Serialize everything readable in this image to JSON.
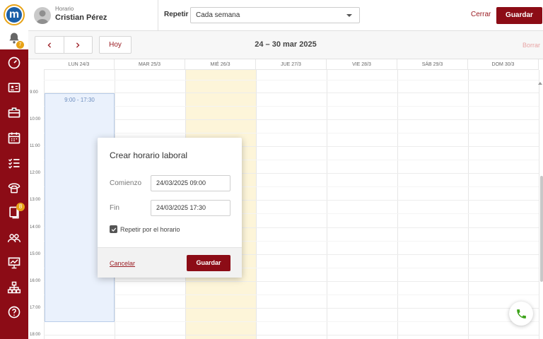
{
  "header": {
    "subtitle": "Horario",
    "user_name": "Cristian Pérez",
    "repeat_label": "Repetir",
    "repeat_value": "Cada semana",
    "cancel_label": "Cerrar",
    "save_label": "Guardar"
  },
  "notifications": {
    "badge": "7"
  },
  "sidebar": {
    "items": [
      {
        "icon": "dashboard-icon"
      },
      {
        "icon": "id-card-icon"
      },
      {
        "icon": "briefcase-icon"
      },
      {
        "icon": "calendar-icon"
      },
      {
        "icon": "checklist-icon"
      },
      {
        "icon": "phone-icon"
      },
      {
        "icon": "documents-icon",
        "badge": "8"
      },
      {
        "icon": "users-icon"
      },
      {
        "icon": "presentation-icon"
      },
      {
        "icon": "org-chart-icon"
      },
      {
        "icon": "help-icon"
      }
    ]
  },
  "toolbar": {
    "today_label": "Hoy",
    "date_range": "24 – 30 mar 2025",
    "clear_label": "Borrar"
  },
  "calendar": {
    "days": [
      "LUN 24/3",
      "MAR 25/3",
      "MIÉ 26/3",
      "JUE 27/3",
      "VIE 28/3",
      "SÁB 29/3",
      "DOM 30/3"
    ],
    "hours": [
      "9:00",
      "10:00",
      "11:00",
      "12:00",
      "13:00",
      "14:00",
      "15:00",
      "16:00",
      "17:00",
      "18:00"
    ],
    "event_label": "9:00 - 17:30"
  },
  "dialog": {
    "title": "Crear horario laboral",
    "start_label": "Comienzo",
    "start_value": "24/03/2025 09:00",
    "end_label": "Fin",
    "end_value": "24/03/2025 17:30",
    "repeat_checkbox": "Repetir por el horario",
    "cancel_label": "Cancelar",
    "save_label": "Guardar"
  },
  "colors": {
    "brand": "#8c0c16",
    "accent": "#e8a317",
    "today_column": "#fdf5d9",
    "event_fill": "#eaf1fc",
    "call_green": "#3da31a"
  }
}
